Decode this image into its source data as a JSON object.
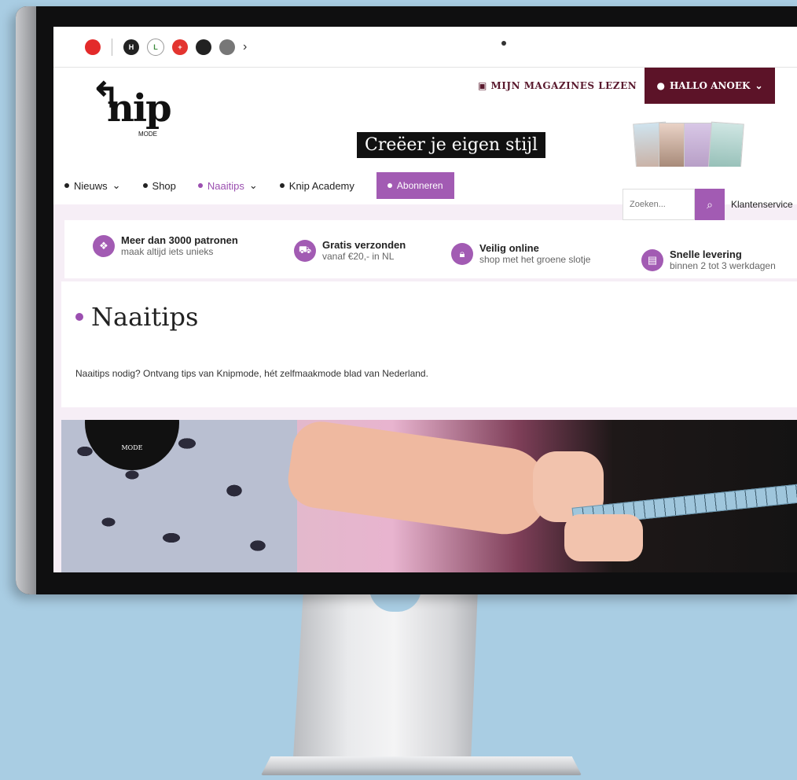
{
  "topbar": {
    "icons": [
      "avrotros-icon",
      "h-icon",
      "green-icon",
      "plus-icon",
      "dark-icon",
      "grey-icon"
    ],
    "chevron": "›"
  },
  "header": {
    "logo_word": "nip",
    "logo_mode": "MODE",
    "magazines_link": "MIJN MAGAZINES LEZEN",
    "account_label": "HALLO ANOEK",
    "tagline": "Creëer je eigen stijl"
  },
  "nav": {
    "items": [
      {
        "label": "Nieuws"
      },
      {
        "label": "Shop"
      },
      {
        "label": "Naaitips"
      },
      {
        "label": "Knip Academy"
      }
    ],
    "subscribe": "Abonneren",
    "search_placeholder": "Zoeken...",
    "service": "Klantenservice"
  },
  "usp": [
    {
      "title": "Meer dan 3000 patronen",
      "sub": "maak altijd iets unieks"
    },
    {
      "title": "Gratis verzonden",
      "sub": "vanaf €20,- in NL"
    },
    {
      "title": "Veilig online",
      "sub": "shop met het groene slotje"
    },
    {
      "title": "Snelle levering",
      "sub": "binnen 2 tot 3 werkdagen"
    }
  ],
  "content": {
    "title": "Naaitips",
    "intro": "Naaitips nodig? Ontvang tips van Knipmode, hét zelfmaakmode blad van Nederland."
  },
  "hero": {
    "logo_mode": "MODE"
  },
  "colors": {
    "accent": "#a25bb3",
    "account_bg": "#5c1328",
    "background": "#a9cde3"
  }
}
